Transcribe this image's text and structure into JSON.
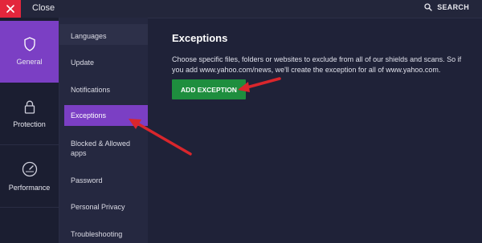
{
  "topbar": {
    "close_label": "Close",
    "search_label": "SEARCH"
  },
  "categories": [
    {
      "label": "General",
      "icon": "shield-icon",
      "active": true
    },
    {
      "label": "Protection",
      "icon": "lock-icon",
      "active": false
    },
    {
      "label": "Performance",
      "icon": "speedometer-icon",
      "active": false
    }
  ],
  "submenu": [
    {
      "label": "Languages"
    },
    {
      "label": "Update"
    },
    {
      "label": "Notifications"
    },
    {
      "label": "Exceptions",
      "active": true
    },
    {
      "label": "Blocked & Allowed apps"
    },
    {
      "label": "Password"
    },
    {
      "label": "Personal Privacy"
    },
    {
      "label": "Troubleshooting"
    }
  ],
  "main": {
    "title": "Exceptions",
    "description": "Choose specific files, folders or websites to exclude from all of our shields and scans. So if you add www.yahoo.com/news, we'll create the exception for all of www.yahoo.com.",
    "add_button_label": "ADD EXCEPTION"
  },
  "colors": {
    "accent_purple": "#7b3fc4",
    "close_red": "#e3263c",
    "button_green": "#1e8e3e",
    "arrow_red": "#d9262c",
    "background": "#1f2238"
  }
}
